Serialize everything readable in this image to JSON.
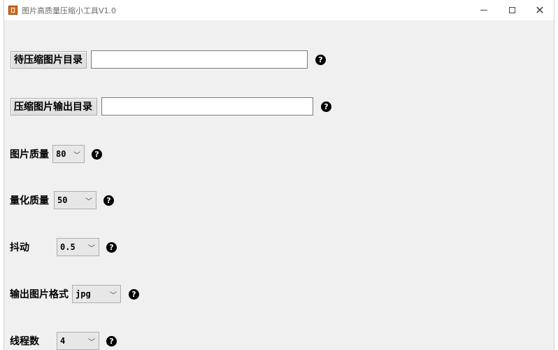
{
  "window": {
    "title": "图片高质量压缩小工具V1.0",
    "controls": {
      "minimize": "minimize-icon",
      "maximize": "maximize-icon",
      "close": "close-icon"
    }
  },
  "form": {
    "input_dir": {
      "button_label": "待压缩图片目录",
      "value": "",
      "help": "?"
    },
    "output_dir": {
      "button_label": "压缩图片输出目录",
      "value": "",
      "help": "?"
    },
    "image_quality": {
      "label": "图片质量",
      "value": "80",
      "help": "?"
    },
    "quant_quality": {
      "label": "量化质量",
      "value": "50",
      "help": "?"
    },
    "dither": {
      "label": "抖动",
      "value": "0.5",
      "help": "?"
    },
    "output_format": {
      "label": "输出图片格式",
      "value": "jpg",
      "help": "?"
    },
    "threads": {
      "label": "线程数",
      "value": "4",
      "help": "?"
    }
  },
  "colors": {
    "background": "#f0f0f0",
    "titlebar": "#ffffff",
    "help_icon": "#000000"
  }
}
